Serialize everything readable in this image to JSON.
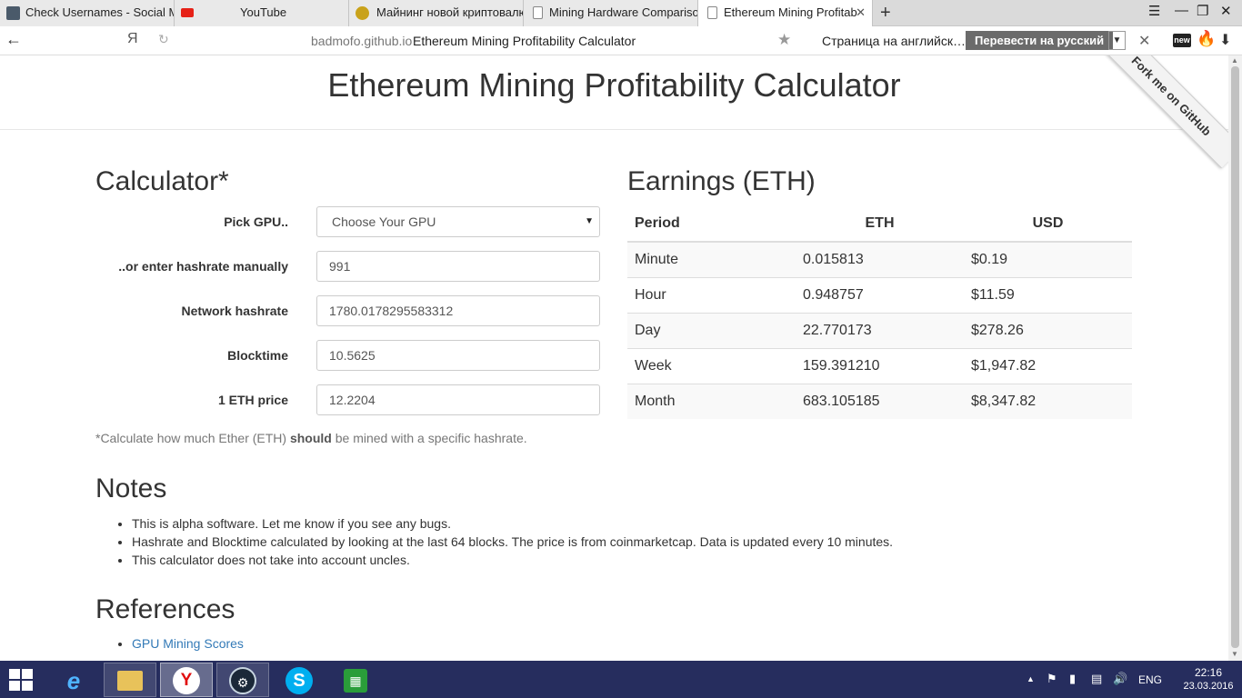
{
  "browser": {
    "tabs": [
      {
        "title": "Check Usernames - Social Me",
        "active": false
      },
      {
        "title": "YouTube",
        "active": false
      },
      {
        "title": "Майнинг новой криптовалю",
        "active": false
      },
      {
        "title": "Mining Hardware Comparison",
        "active": false
      },
      {
        "title": "Ethereum Mining Profitab",
        "active": true
      }
    ],
    "new_tab": "+",
    "address": {
      "host": "badmofo.github.io",
      "title": "Ethereum Mining Profitability Calculator"
    },
    "yandex_glyph": "Я",
    "translate": {
      "prompt": "Страница на английск…",
      "button": "Перевести на русский"
    },
    "ext_badge": "new"
  },
  "page": {
    "title": "Ethereum Mining Profitability Calculator",
    "ribbon": "Fork me on GitHub",
    "calculator": {
      "heading": "Calculator*",
      "gpu_label": "Pick GPU..",
      "gpu_value": "Choose Your GPU",
      "hashrate_label": "..or enter hashrate manually",
      "hashrate_value": "991",
      "network_label": "Network hashrate",
      "network_value": "1780.0178295583312",
      "blocktime_label": "Blocktime",
      "blocktime_value": "10.5625",
      "price_label": "1 ETH price",
      "price_value": "12.2204",
      "help_prefix": "*Calculate how much Ether (ETH) ",
      "help_bold": "should",
      "help_suffix": " be mined with a specific hashrate."
    },
    "earnings": {
      "heading": "Earnings (ETH)",
      "columns": [
        "Period",
        "ETH",
        "USD"
      ],
      "rows": [
        {
          "period": "Minute",
          "eth": "0.015813",
          "usd": "$0.19"
        },
        {
          "period": "Hour",
          "eth": "0.948757",
          "usd": "$11.59"
        },
        {
          "period": "Day",
          "eth": "22.770173",
          "usd": "$278.26"
        },
        {
          "period": "Week",
          "eth": "159.391210",
          "usd": "$1,947.82"
        },
        {
          "period": "Month",
          "eth": "683.105185",
          "usd": "$8,347.82"
        }
      ]
    },
    "notes": {
      "heading": "Notes",
      "items": [
        "This is alpha software. Let me know if you see any bugs.",
        "Hashrate and Blocktime calculated by looking at the last 64 blocks. The price is from coinmarketcap. Data is updated every 10 minutes.",
        "This calculator does not take into account uncles."
      ]
    },
    "references": {
      "heading": "References",
      "items": [
        "GPU Mining Scores"
      ]
    }
  },
  "taskbar": {
    "lang": "ENG",
    "time": "22:16",
    "date": "23.03.2016"
  },
  "colors": {
    "link": "#337ab7",
    "taskbar": "#262d5e",
    "youtube": "#e62117"
  }
}
